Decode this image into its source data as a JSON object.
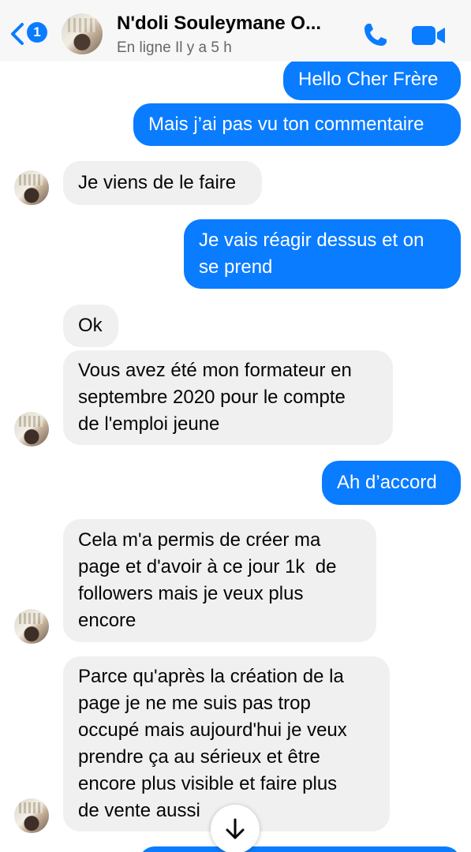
{
  "header": {
    "back_badge": "1",
    "contact_name": "N'doli Souleymane O...",
    "status": "En ligne Il y a 5 h",
    "icons": [
      "chevron-left-icon",
      "phone-icon",
      "video-camera-icon"
    ]
  },
  "messages": [
    {
      "dir": "out",
      "lines": [
        "Hello Cher Frère"
      ]
    },
    {
      "dir": "out",
      "lines": [
        "Mais j’ai pas vu ton commentaire"
      ]
    },
    {
      "dir": "in",
      "lines": [
        "Je viens de le faire"
      ]
    },
    {
      "dir": "out",
      "lines": [
        "Je vais réagir dessus et on",
        "se prend"
      ]
    },
    {
      "dir": "in",
      "lines": [
        "Ok"
      ]
    },
    {
      "dir": "in",
      "lines": [
        "Vous avez été mon formateur en",
        "septembre 2020 pour le compte",
        "de l'emploi jeune"
      ]
    },
    {
      "dir": "out",
      "lines": [
        "Ah d’accord"
      ]
    },
    {
      "dir": "in",
      "lines": [
        "Cela m'a permis de créer ma",
        "page et d'avoir à ce jour 1k  de",
        "followers mais je veux plus",
        "encore"
      ]
    },
    {
      "dir": "in",
      "lines": [
        "Parce qu'après la création de la",
        "page je ne me suis pas trop",
        "occupé mais aujourd'hui je veux",
        "prendre ça au sérieux et être",
        "encore plus visible et faire plus",
        "de vente aussi"
      ]
    }
  ],
  "colors": {
    "outgoing": "#0a7cff",
    "incoming": "#f0f0f0",
    "accent": "#0a7cff"
  },
  "scroll_button_icon": "arrow-down-icon"
}
